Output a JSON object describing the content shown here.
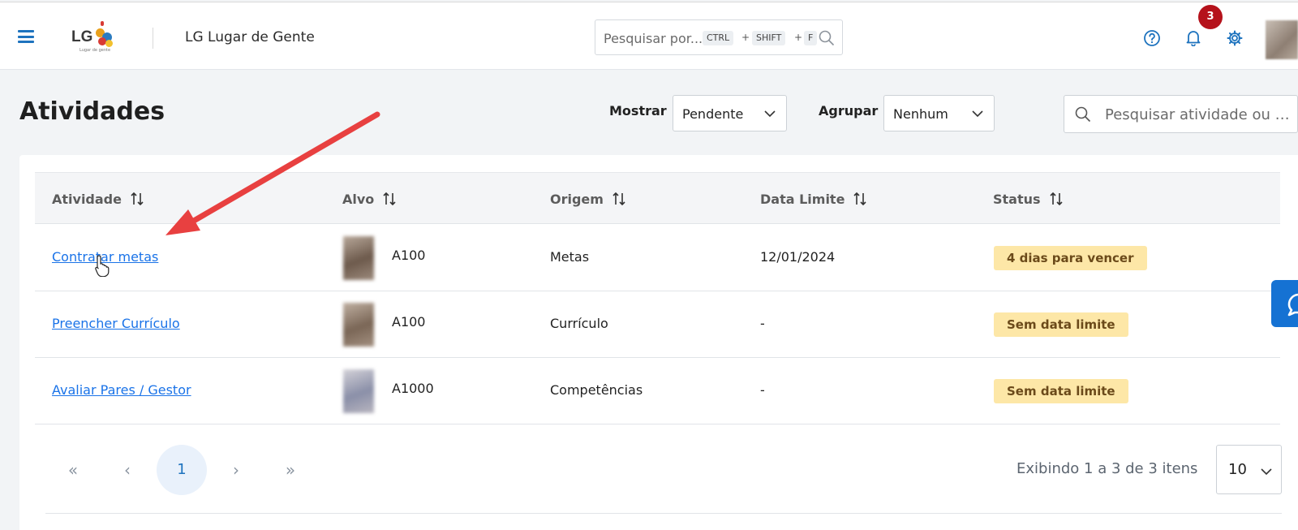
{
  "header": {
    "logo_text": "LG",
    "logo_sub": "Lugar de gente",
    "app_title": "LG Lugar de Gente",
    "search_placeholder": "Pesquisar por...",
    "shortcut": {
      "k1": "CTRL",
      "p1": "+",
      "k2": "SHIFT",
      "p2": "+",
      "k3": "F"
    },
    "notification_count": "3"
  },
  "page": {
    "title": "Atividades",
    "show_label": "Mostrar",
    "show_value": "Pendente",
    "group_label": "Agrupar",
    "group_value": "Nenhum",
    "search_placeholder": "Pesquisar atividade ou alvo"
  },
  "table": {
    "columns": [
      "Atividade",
      "Alvo",
      "Origem",
      "Data Limite",
      "Status"
    ],
    "rows": [
      {
        "activity": "Contratar metas",
        "target": "A100",
        "origin": "Metas",
        "deadline": "12/01/2024",
        "status": "4 dias para vencer"
      },
      {
        "activity": "Preencher Currículo",
        "target": "A100",
        "origin": "Currículo",
        "deadline": "-",
        "status": "Sem data limite"
      },
      {
        "activity": "Avaliar Pares / Gestor",
        "target": "A1000",
        "origin": "Competências",
        "deadline": "-",
        "status": "Sem data limite"
      }
    ]
  },
  "pagination": {
    "first": "«",
    "prev": "‹",
    "current_page": "1",
    "next": "›",
    "last": "»",
    "showing": "Exibindo 1 a 3 de 3 itens",
    "page_size": "10"
  },
  "colors": {
    "accent": "#1e73be",
    "link": "#1a73e8",
    "badge": "#b5121b",
    "status_bg": "#fde7a7",
    "arrow": "#e84040"
  },
  "icons": [
    "menu-icon",
    "search-icon",
    "help-icon",
    "bell-icon",
    "gear-icon",
    "sort-icon",
    "chevron-down-icon",
    "chat-icon"
  ]
}
